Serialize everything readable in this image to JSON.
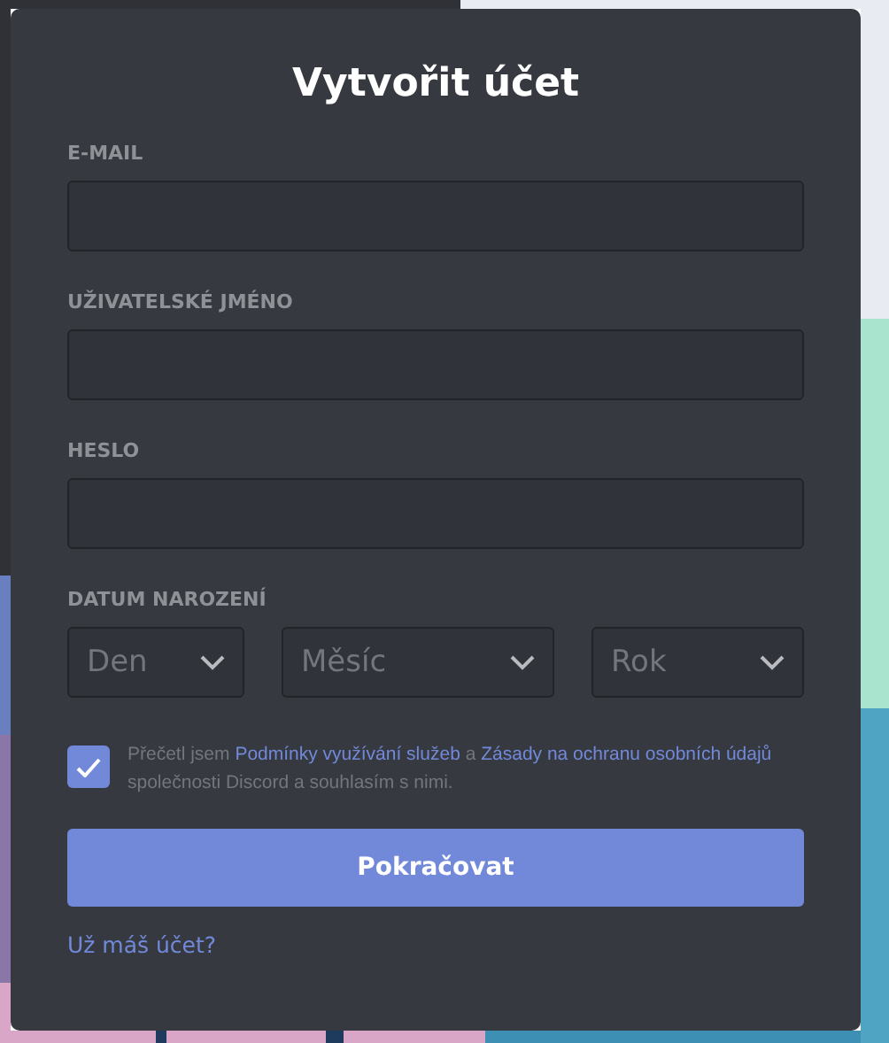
{
  "title": "Vytvořit účet",
  "fields": [
    {
      "label": "E-MAIL"
    },
    {
      "label": "UŽIVATELSKÉ JMÉNO"
    },
    {
      "label": "HESLO"
    }
  ],
  "birthdate": {
    "label": "DATUM NAROZENÍ",
    "selects": [
      {
        "placeholder": "Den"
      },
      {
        "placeholder": "Měsíc"
      },
      {
        "placeholder": "Rok"
      }
    ]
  },
  "agreement": {
    "checked": true,
    "before": "Přečetl jsem",
    "terms_link": "Podmínky využívání služeb",
    "middle": "a",
    "privacy_link": "Zásady na ochranu osobních údajů",
    "after": "společnosti Discord a souhlasím s nimi."
  },
  "submit": "Pokračovat",
  "login_link": "Už máš účet?"
}
